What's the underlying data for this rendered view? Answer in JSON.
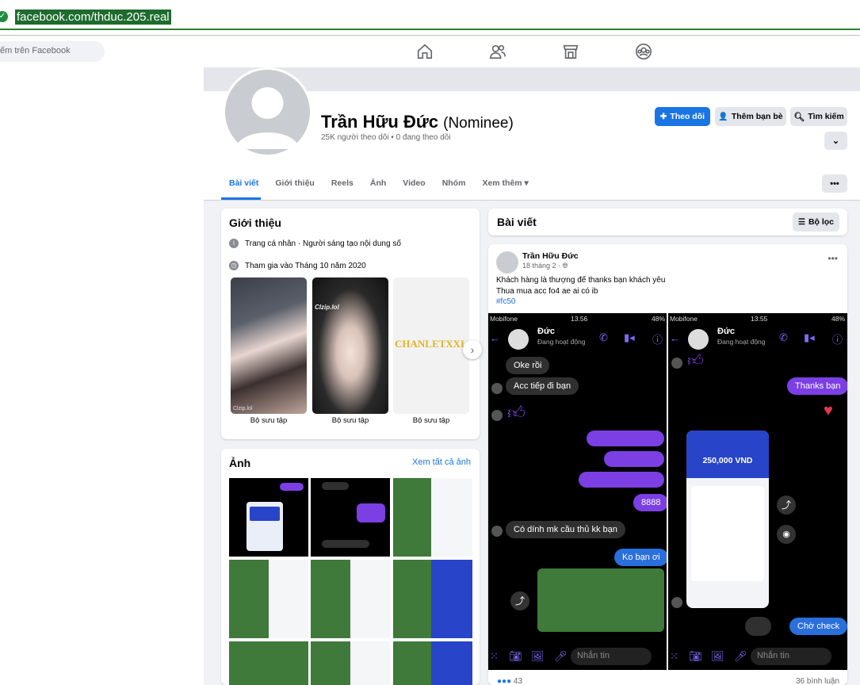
{
  "browser": {
    "url": "facebook.com/thduc.205.real"
  },
  "fbnav": {
    "search_placeholder": "ếm trên Facebook",
    "icons": [
      "home-icon",
      "friends-icon",
      "marketplace-icon",
      "groups-icon"
    ]
  },
  "profile": {
    "name": "Trần Hữu Đức",
    "suffix": "(Nominee)",
    "stats": "25K người theo dõi • 0 đang theo dõi",
    "follow_label": "Theo dõi",
    "add_friend_label": "Thêm bạn bè",
    "search_label": "Tìm kiếm"
  },
  "tabs": [
    {
      "label": "Bài viết"
    },
    {
      "label": "Giới thiệu"
    },
    {
      "label": "Reels"
    },
    {
      "label": "Ảnh"
    },
    {
      "label": "Video"
    },
    {
      "label": "Nhóm"
    },
    {
      "label": "Xem thêm ▾"
    }
  ],
  "intro": {
    "title": "Giới thiệu",
    "rows": [
      "Trang cá nhân · Người sáng tạo nội dung số",
      "Tham gia vào Tháng 10 năm 2020"
    ],
    "collections": [
      {
        "label": "Bộ sưu tập",
        "watermark": "Clzip.lol"
      },
      {
        "label": "Bộ sưu tập",
        "watermark": "Clzip.lol"
      },
      {
        "label": "Bộ sưu tập",
        "watermark": "CHANLETXXL.CO"
      }
    ]
  },
  "photos": {
    "title": "Ảnh",
    "see_all": "Xem tất cả ảnh"
  },
  "posts_card": {
    "title": "Bài viết",
    "filter_label": "Bộ lọc"
  },
  "post": {
    "author": "Trần Hữu Đức",
    "time": "18 tháng 2 · ",
    "line1": "Khách hàng là thượng đế thanks bạn khách yêu",
    "line2": "Thua mua acc fo4 ae ai có ib",
    "hashtag": "#fc50",
    "reaction_count": "43",
    "comments": "36 bình luận"
  },
  "shot_left": {
    "carrier": "Mobifone",
    "time": "13:56",
    "battery": "48%",
    "contact": "Đức",
    "status": "Đang hoạt động",
    "msgs": {
      "m1": "Oke rồi",
      "m2": "Acc tiếp đi bạn",
      "m3": "8888",
      "m4": "Có dính mk cầu thủ kk bạn",
      "m5": "Ko bạn ơi"
    },
    "input_placeholder": "Nhắn tin"
  },
  "shot_right": {
    "carrier": "Mobifone",
    "time": "13:55",
    "battery": "48%",
    "contact": "Đức",
    "status": "Đang hoạt động",
    "msgs": {
      "m1": "Thanks bạn",
      "m2": "Chờ check"
    },
    "receipt_amount": "250,000 VND",
    "input_placeholder": "Nhắn tin"
  },
  "colors": {
    "fb_blue": "#1b74e4",
    "messenger_purple": "#7b3fe4",
    "bg": "#f0f2f5"
  }
}
